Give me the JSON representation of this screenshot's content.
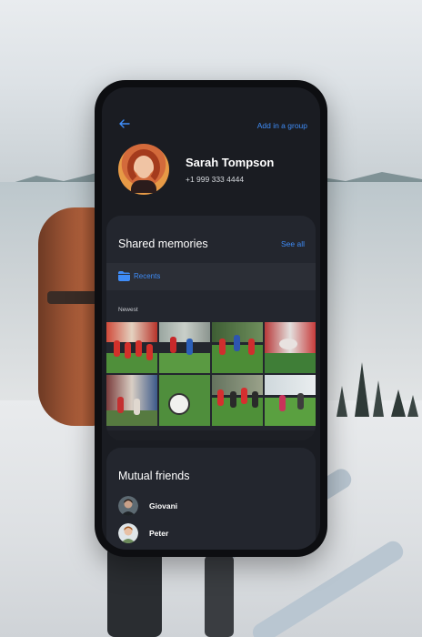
{
  "header": {
    "add_group_label": "Add in a group"
  },
  "profile": {
    "name": "Sarah Tompson",
    "phone": "+1 999 333 4444"
  },
  "shared_memories": {
    "title": "Shared memories",
    "see_all_label": "See all",
    "recents_label": "Recents",
    "section_label": "Newest"
  },
  "mutual_friends": {
    "title": "Mutual friends",
    "friends": [
      {
        "name": "Giovani"
      },
      {
        "name": "Peter"
      }
    ]
  },
  "colors": {
    "accent": "#3f8cf7",
    "card": "#23262e",
    "screen": "#1a1c22"
  }
}
